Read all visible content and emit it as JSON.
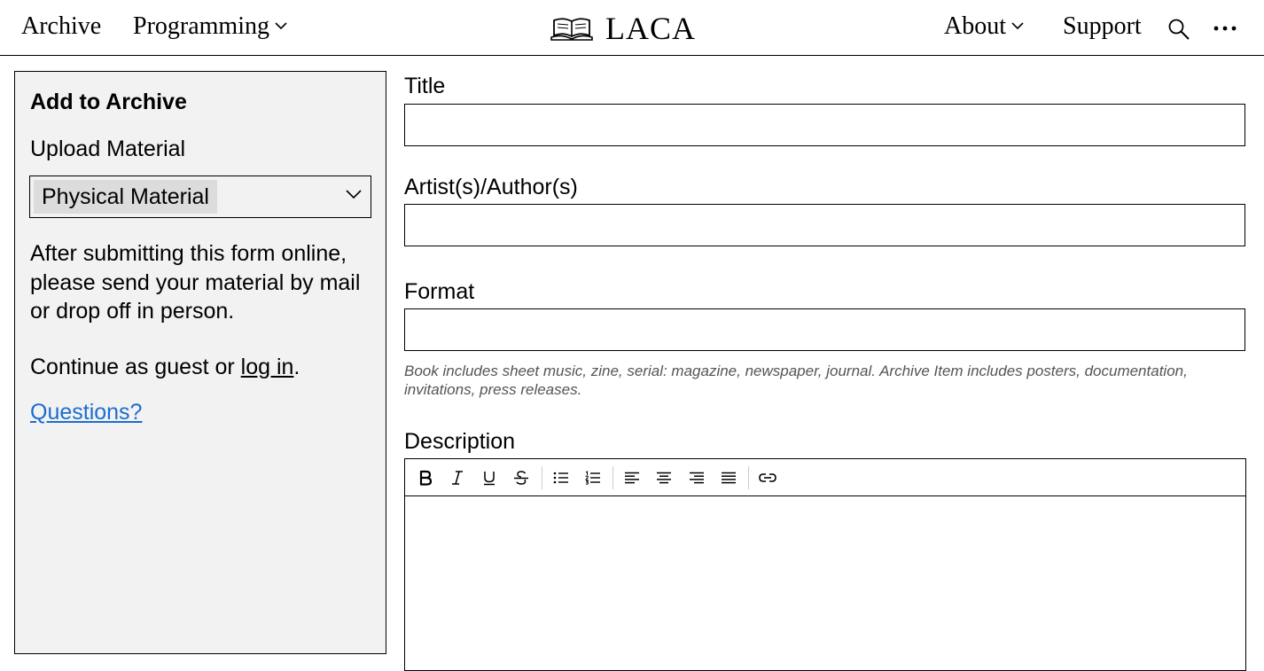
{
  "nav": {
    "archive": "Archive",
    "programming": "Programming",
    "logo": "LACA",
    "about": "About",
    "support": "Support",
    "icons": {
      "logo": "open-book-icon",
      "search": "search-icon",
      "more": "more-horizontal-icon",
      "dropdown": "chevron-down-icon"
    }
  },
  "sidebar": {
    "title": "Add to Archive",
    "upload_label": "Upload Material",
    "upload_selected": "Physical Material",
    "paragraph": "After submitting this form online, please send your material by mail or drop off in person.",
    "guest_prefix": "Continue as guest or ",
    "login_link": "log in",
    "guest_suffix": ".",
    "questions_link": "Questions?"
  },
  "form": {
    "title_label": "Title",
    "title_value": "",
    "artists_label": "Artist(s)/Author(s)",
    "artists_value": "",
    "format_label": "Format",
    "format_value": "",
    "format_help": "Book includes sheet music, zine, serial: magazine, newspaper, journal. Archive Item includes posters, documentation, invitations, press releases.",
    "description_label": "Description",
    "toolbar": [
      "bold-icon",
      "italic-icon",
      "underline-icon",
      "strikethrough-icon",
      "bullet-list-icon",
      "numbered-list-icon",
      "align-left-icon",
      "align-center-icon",
      "align-right-icon",
      "align-justify-icon",
      "link-icon"
    ]
  },
  "colors": {
    "sidebar_bg": "#f2f2f2",
    "link": "#1a6dd1",
    "help_text": "#555555"
  }
}
